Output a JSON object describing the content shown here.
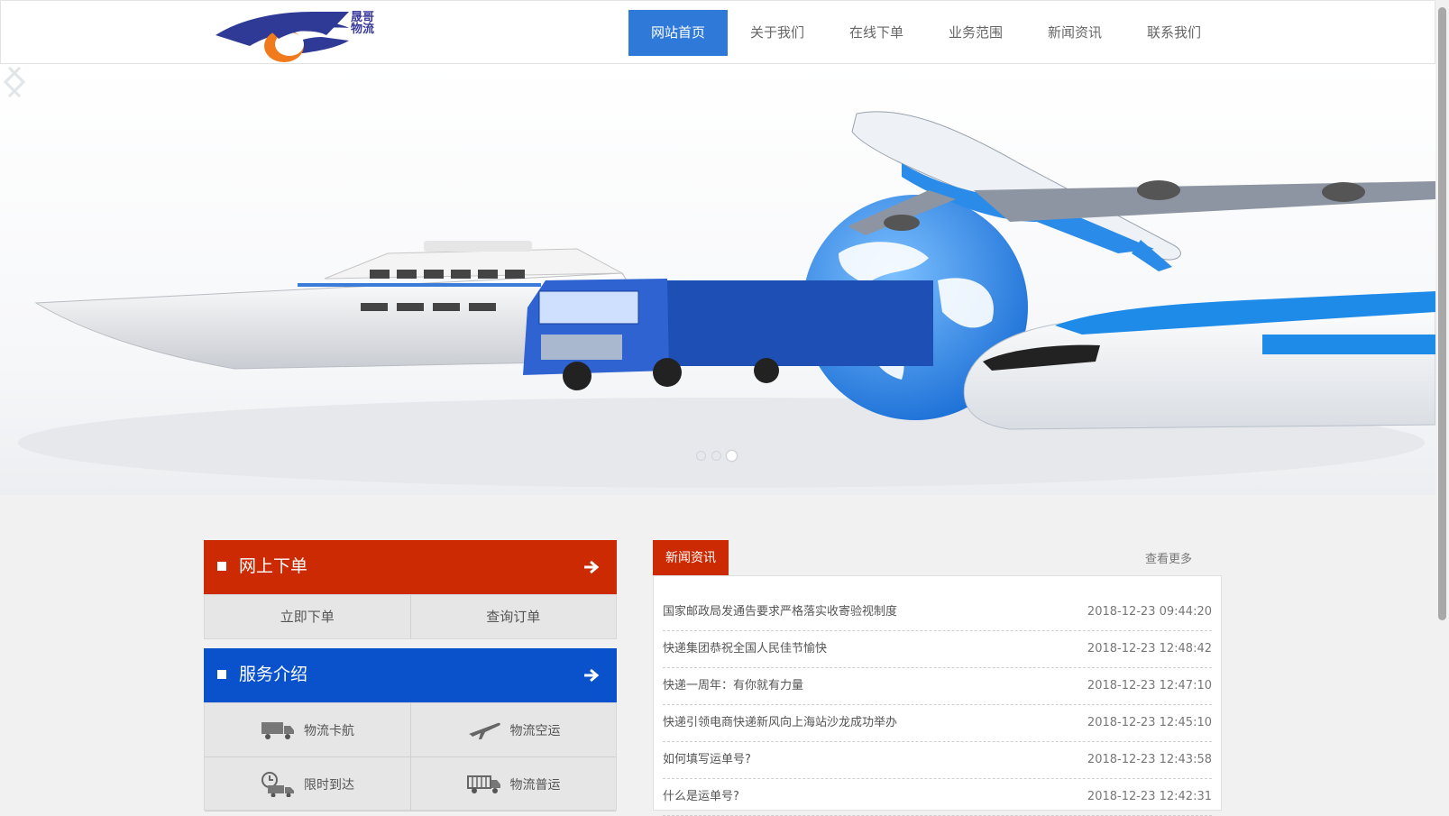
{
  "brand": {
    "logo_text": "晟哥物流",
    "colors": {
      "blue": "#2e3a96",
      "orange": "#f07a1c"
    }
  },
  "nav": {
    "items": [
      {
        "label": "网站首页",
        "active": true
      },
      {
        "label": "关于我们"
      },
      {
        "label": "在线下单"
      },
      {
        "label": "业务范围"
      },
      {
        "label": "新闻资讯"
      },
      {
        "label": "联系我们"
      }
    ]
  },
  "banner": {
    "image": "ship-truck-globe-airplane-train",
    "slides": 3,
    "active_slide": 3,
    "prev_icon": "chevron-left-icon",
    "next_icon": "chevron-right-icon"
  },
  "order_panel": {
    "title": "网上下单",
    "color": "#cc2a02",
    "buttons": [
      "立即下单",
      "查询订单"
    ]
  },
  "service_panel": {
    "title": "服务介绍",
    "color": "#0a52cc",
    "items": [
      {
        "label": "物流卡航",
        "icon": "truck-icon"
      },
      {
        "label": "物流空运",
        "icon": "airplane-icon"
      },
      {
        "label": "限时到达",
        "icon": "clock-truck-icon"
      },
      {
        "label": "物流普运",
        "icon": "freight-truck-icon"
      }
    ]
  },
  "news": {
    "tab": "新闻资讯",
    "more": "查看更多",
    "items": [
      {
        "title": "国家邮政局发通告要求严格落实收寄验视制度",
        "date": "2018-12-23 09:44:20"
      },
      {
        "title": "快递集团恭祝全国人民佳节愉快",
        "date": "2018-12-23 12:48:42"
      },
      {
        "title": "快递一周年：有你就有力量",
        "date": "2018-12-23 12:47:10"
      },
      {
        "title": "快递引领电商快递新风向上海站沙龙成功举办",
        "date": "2018-12-23 12:45:10"
      },
      {
        "title": "如何填写运单号?",
        "date": "2018-12-23 12:43:58"
      },
      {
        "title": "什么是运单号?",
        "date": "2018-12-23 12:42:31"
      }
    ]
  }
}
